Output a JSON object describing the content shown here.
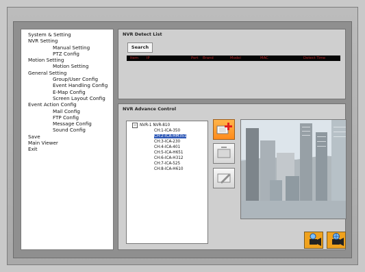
{
  "sidebar": [
    {
      "label": "System & Setting",
      "level": 0
    },
    {
      "label": "NVR Setting",
      "level": 0
    },
    {
      "label": "Manual Setting",
      "level": 2
    },
    {
      "label": "PTZ Config",
      "level": 2
    },
    {
      "label": "Motion Setting",
      "level": 0
    },
    {
      "label": "Motion Setting",
      "level": 2
    },
    {
      "label": "General Setting",
      "level": 0
    },
    {
      "label": "Group/User Config",
      "level": 2
    },
    {
      "label": "Event Handling Config",
      "level": 2
    },
    {
      "label": "E-Map Config",
      "level": 2
    },
    {
      "label": "Screen Layout Config",
      "level": 2
    },
    {
      "label": "Event Action Config",
      "level": 0
    },
    {
      "label": "Mail Config",
      "level": 2
    },
    {
      "label": "FTP Config",
      "level": 2
    },
    {
      "label": "Message Config",
      "level": 2
    },
    {
      "label": "Sound Config",
      "level": 2
    },
    {
      "label": "Save",
      "level": 0
    },
    {
      "label": "Main Viewer",
      "level": 0
    },
    {
      "label": "Exit",
      "level": 0
    }
  ],
  "detect": {
    "title": "NVR Detect List",
    "search_label": "Search",
    "columns": [
      "Item",
      "IP",
      "Port",
      "Brand",
      "Model",
      "MAC",
      "Detect Time"
    ]
  },
  "advance": {
    "title": "NVR Advance Control",
    "root": "NVR-1 NVR-810",
    "channels": [
      "CH:1-ICA-350",
      "CH:2-ICA-HM351",
      "CH:3-ICA-230",
      "CH:4-ICA-401",
      "CH:5-ICA-H651",
      "CH:6-ICA-H312",
      "CH:7-ICA-525",
      "CH:8-ICA-H610"
    ],
    "selected_index": 1
  },
  "colors": {
    "accent": "#f08c1b",
    "selection": "#2b56b5",
    "header_text": "#b72a2a"
  }
}
